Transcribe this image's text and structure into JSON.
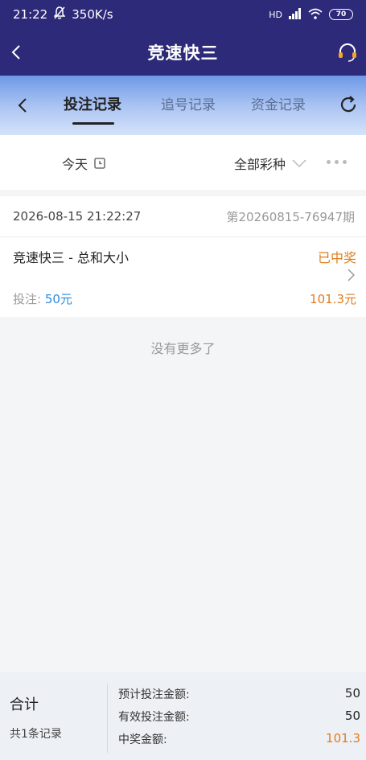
{
  "status_bar": {
    "time": "21:22",
    "speed": "350K/s",
    "network": "HD",
    "battery": "70"
  },
  "app_bar": {
    "title": "竞速快三"
  },
  "tabs": [
    {
      "label": "投注记录",
      "active": true
    },
    {
      "label": "追号记录",
      "active": false
    },
    {
      "label": "资金记录",
      "active": false
    }
  ],
  "filter": {
    "date": "今天",
    "lottery": "全部彩种"
  },
  "records": [
    {
      "time": "2026-08-15 21:22:27",
      "issue": "第20260815-76947期",
      "name": "竞速快三 - 总和大小",
      "status": "已中奖",
      "bet_label": "投注: ",
      "bet_amount": "50元",
      "win_amount": "101.3元"
    }
  ],
  "no_more_text": "没有更多了",
  "summary": {
    "title": "合计",
    "count": "共1条记录",
    "rows": [
      {
        "label": "预计投注金额:",
        "value": "50"
      },
      {
        "label": "有效投注金额:",
        "value": "50"
      },
      {
        "label": "中奖金额:",
        "value": "101.3"
      }
    ]
  },
  "colors": {
    "header_bg": "#2e2a7a",
    "win_orange": "#e07c1c",
    "bet_blue": "#2a8be0"
  }
}
